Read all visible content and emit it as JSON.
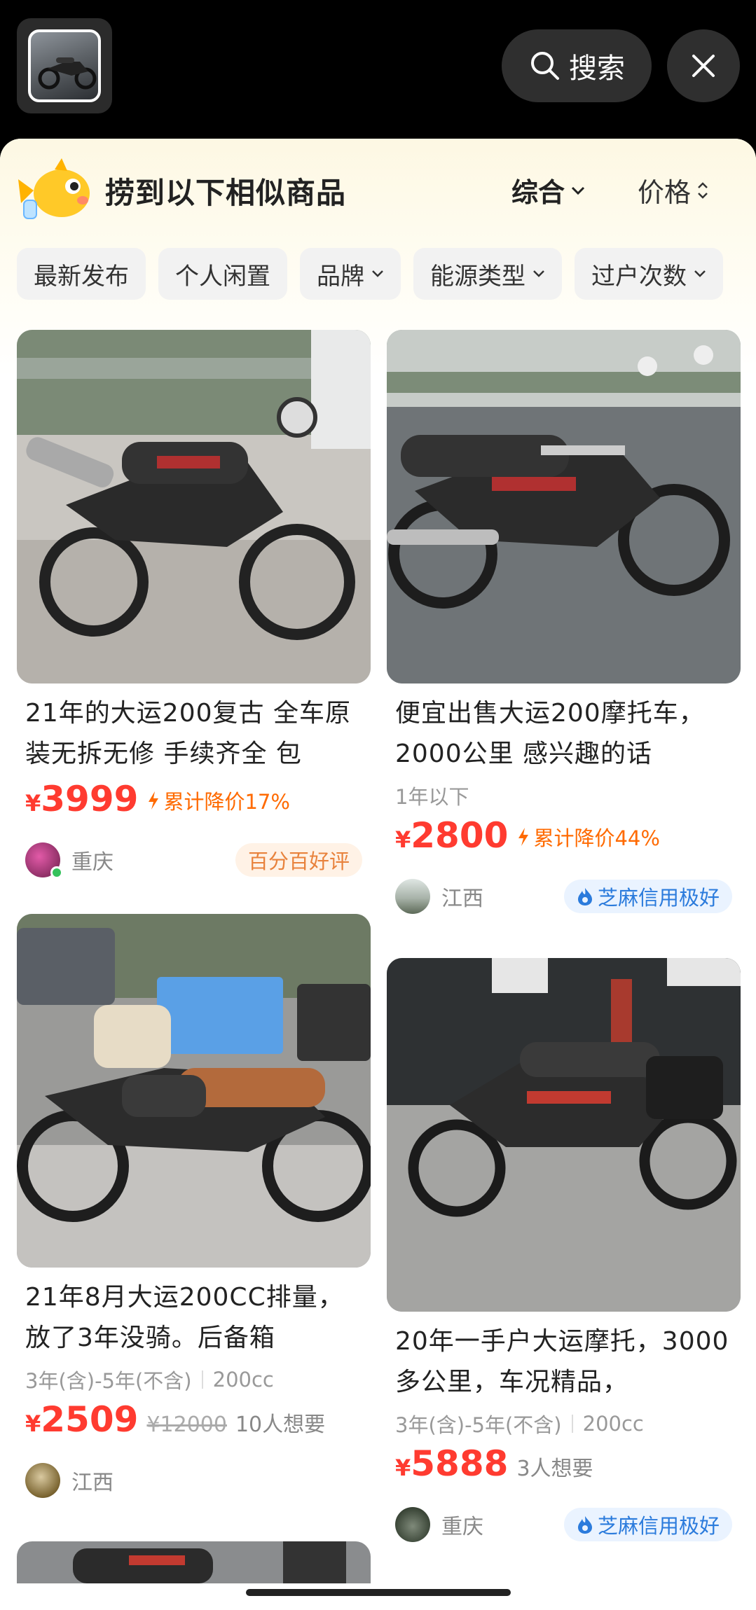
{
  "search": {
    "label": "搜索"
  },
  "header": {
    "title": "捞到以下相似商品",
    "sort_main": "综合",
    "sort_price": "价格"
  },
  "filters": [
    {
      "label": "最新发布",
      "dropdown": false
    },
    {
      "label": "个人闲置",
      "dropdown": false
    },
    {
      "label": "品牌",
      "dropdown": true
    },
    {
      "label": "能源类型",
      "dropdown": true
    },
    {
      "label": "过户次数",
      "dropdown": true
    }
  ],
  "colors": {
    "price": "#ff3b30",
    "drop": "#ff6a00",
    "zhima": "#2b7bdc",
    "good_badge": "#e8823c"
  },
  "items": [
    {
      "title": "21年的大运200复古 全车原装无拆无修 手续齐全 包",
      "currency": "¥",
      "price": "3999",
      "drop": "累计降价17%",
      "city": "重庆",
      "badge": "百分百好评"
    },
    {
      "title": "便宜出售大运200摩托车，2000公里 感兴趣的话",
      "meta1": "1年以下",
      "currency": "¥",
      "price": "2800",
      "drop": "累计降价44%",
      "city": "江西",
      "badge": "芝麻信用极好"
    },
    {
      "title": "21年8月大运200CC排量，放了3年没骑。后备箱",
      "meta1": "3年(含)-5年(不含)",
      "meta2": "200cc",
      "currency": "¥",
      "price": "2509",
      "old_price": "¥12000",
      "want": "10人想要",
      "city": "江西"
    },
    {
      "title": "20年一手户大运摩托，3000多公里，车况精品，",
      "meta1": "3年(含)-5年(不含)",
      "meta2": "200cc",
      "currency": "¥",
      "price": "5888",
      "want": "3人想要",
      "city": "重庆",
      "badge": "芝麻信用极好"
    }
  ]
}
